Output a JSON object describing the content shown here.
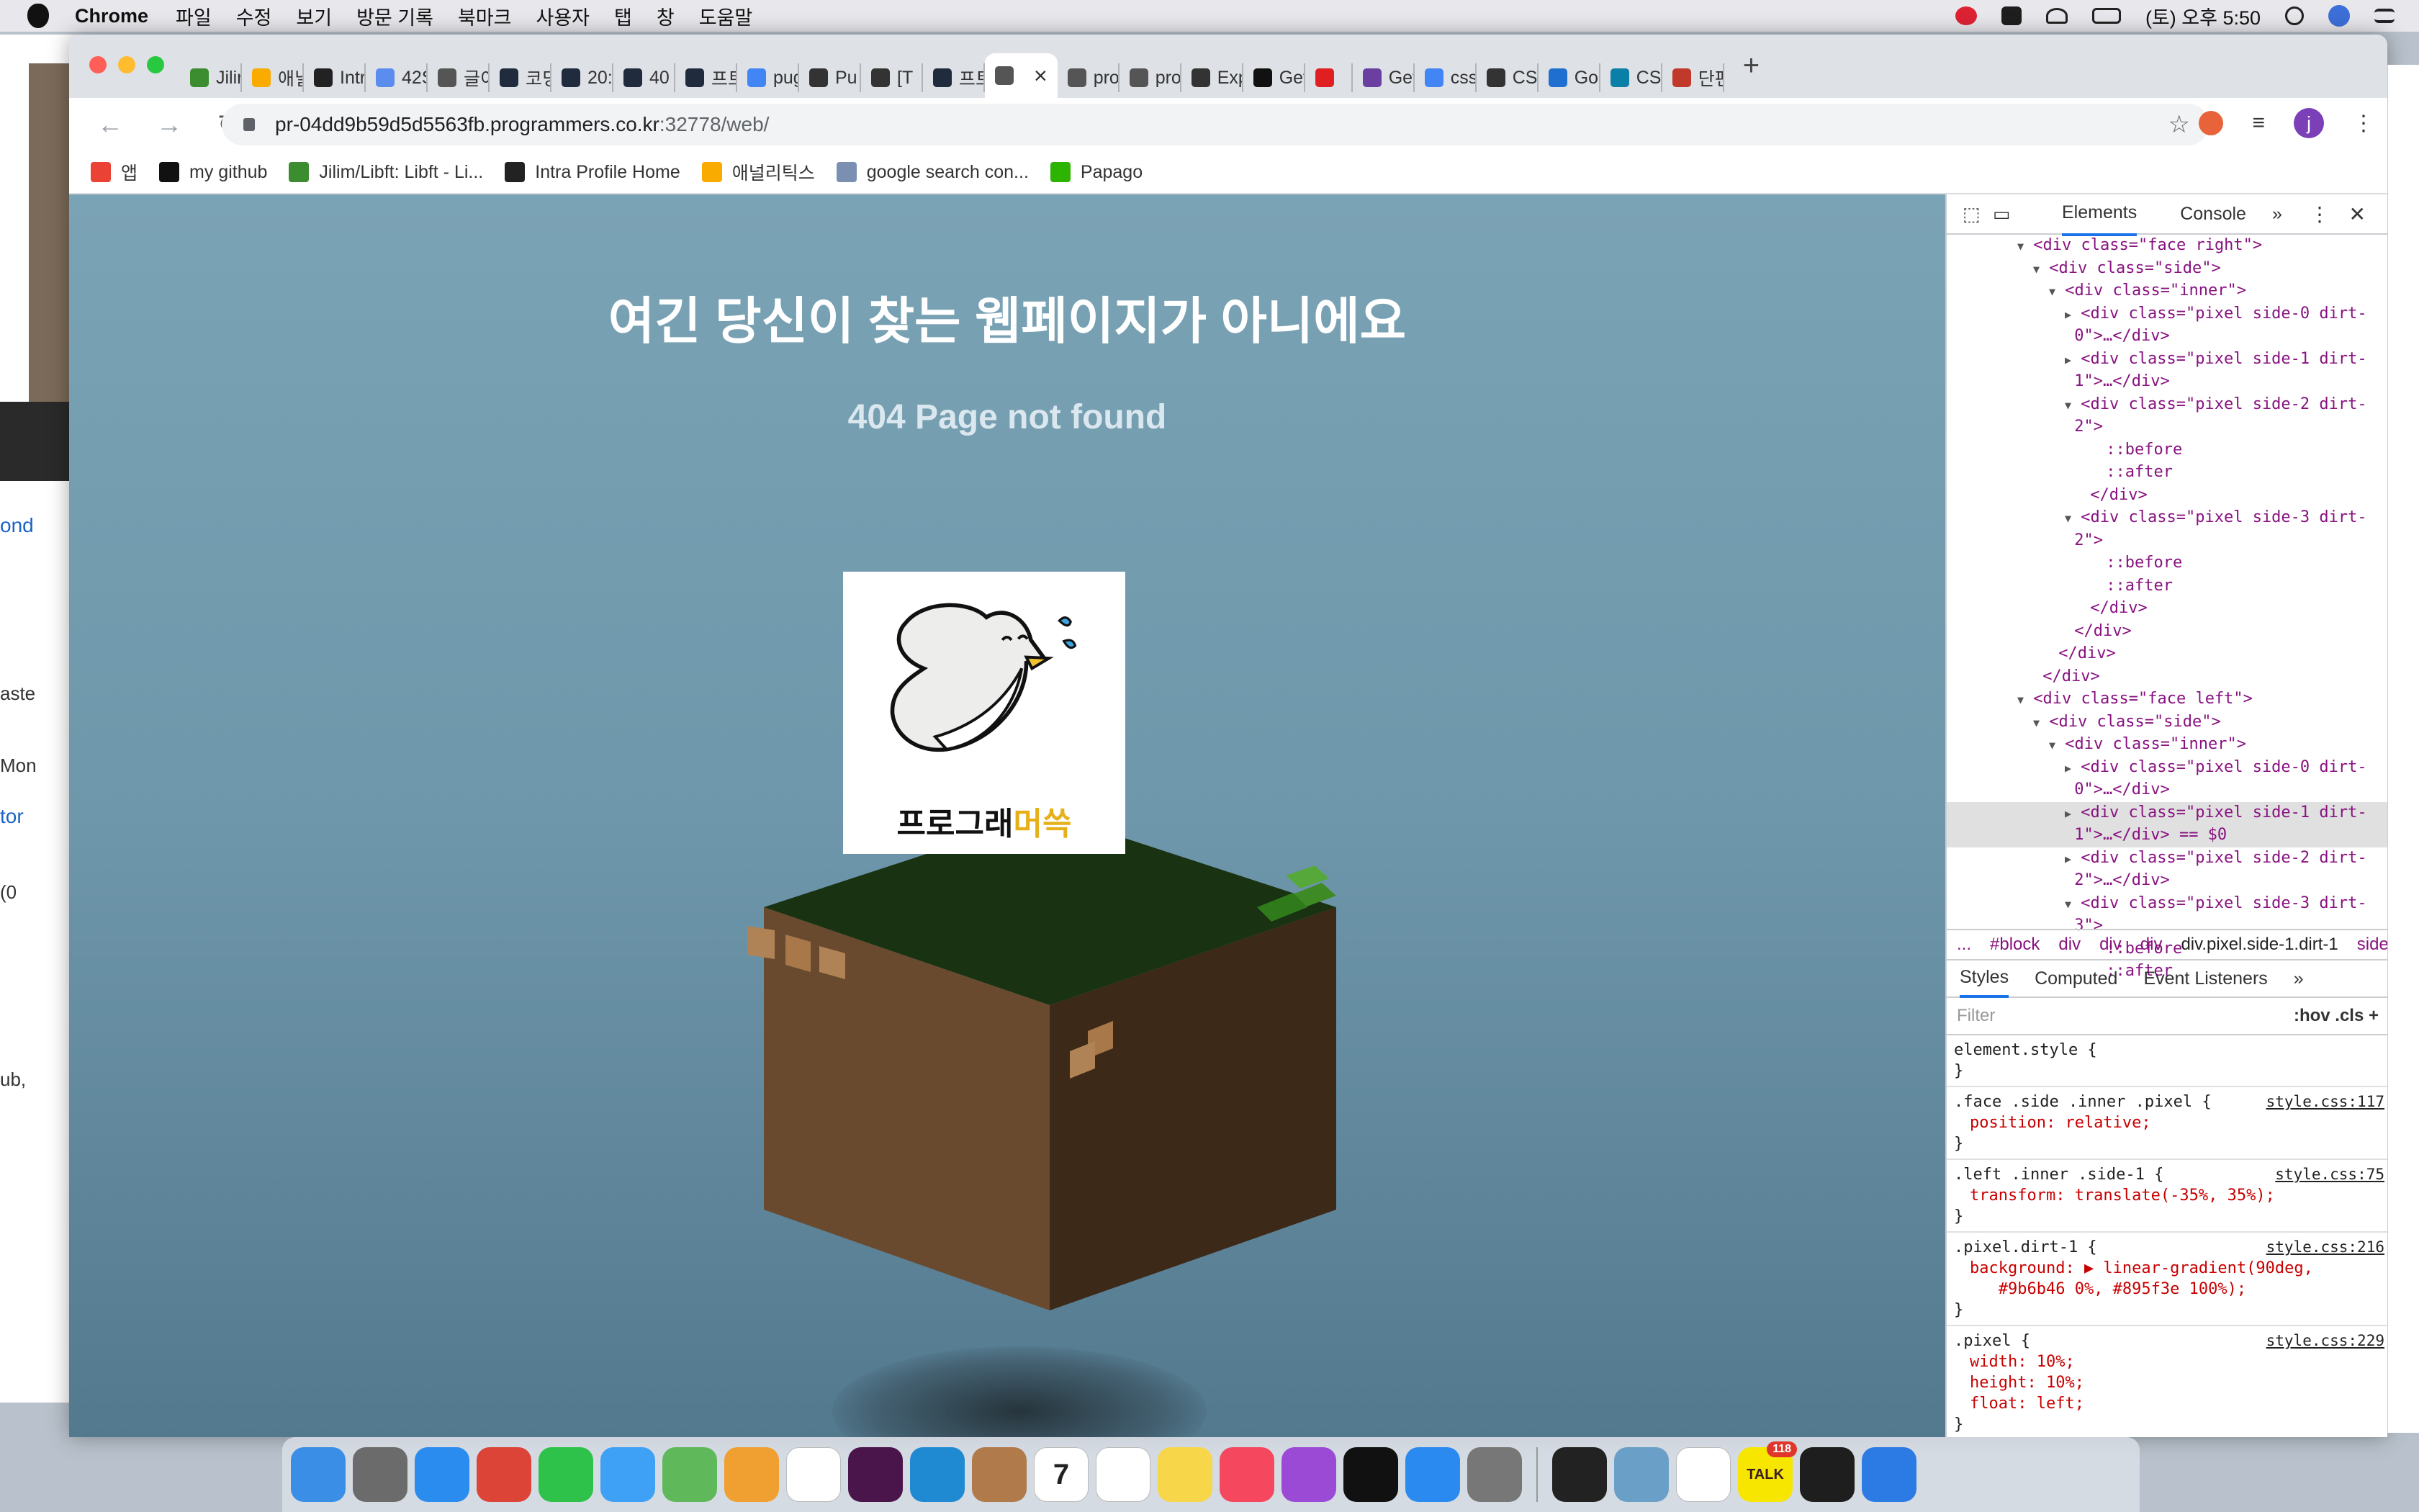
{
  "menubar": {
    "app": "Chrome",
    "items": [
      "파일",
      "수정",
      "보기",
      "방문 기록",
      "북마크",
      "사용자",
      "탭",
      "창",
      "도움말"
    ],
    "clock": "(토) 오후 5:50"
  },
  "background_window": {
    "texts": [
      "ond",
      "aste",
      "Mon",
      "tor",
      "(0",
      "ub,"
    ]
  },
  "tabs": [
    {
      "label": "Jilir",
      "color": "#3c8d2f"
    },
    {
      "label": "애닐",
      "color": "#f9ab00"
    },
    {
      "label": "Intr",
      "color": "#222"
    },
    {
      "label": "42S",
      "color": "#5b8def"
    },
    {
      "label": "글이",
      "color": "#555"
    },
    {
      "label": "코딩",
      "color": "#202b3d"
    },
    {
      "label": "20:",
      "color": "#202b3d"
    },
    {
      "label": "40",
      "color": "#202b3d"
    },
    {
      "label": "프트",
      "color": "#202b3d"
    },
    {
      "label": "pug",
      "color": "#4285f4"
    },
    {
      "label": "Pu",
      "color": "#333"
    },
    {
      "label": "[T",
      "color": "#333"
    },
    {
      "label": "프트",
      "color": "#202b3d"
    },
    {
      "label": "",
      "color": "#555",
      "active": true
    },
    {
      "label": "pro",
      "color": "#555"
    },
    {
      "label": "pro",
      "color": "#555"
    },
    {
      "label": "Exp",
      "color": "#333"
    },
    {
      "label": "Get",
      "color": "#111"
    },
    {
      "label": "",
      "color": "#e02020"
    },
    {
      "label": "Get",
      "color": "#6b3fa0"
    },
    {
      "label": "css",
      "color": "#4285f4"
    },
    {
      "label": "CS",
      "color": "#333"
    },
    {
      "label": "Go",
      "color": "#1f6fd1"
    },
    {
      "label": "CS",
      "color": "#0a7fa8"
    },
    {
      "label": "단편",
      "color": "#c0392b"
    }
  ],
  "omnibox": {
    "host": "pr-04dd9b59d5d5563fb.programmers.co.kr",
    "rest": ":32778/web/"
  },
  "bookmarks": [
    {
      "label": "앱",
      "color": "#ea4335"
    },
    {
      "label": "my github",
      "color": "#111"
    },
    {
      "label": "Jilim/Libft: Libft - Li...",
      "color": "#3c8d2f"
    },
    {
      "label": "Intra Profile Home",
      "color": "#222"
    },
    {
      "label": "애널리틱스",
      "color": "#f9ab00"
    },
    {
      "label": "google search con...",
      "color": "#7b8fb0"
    },
    {
      "label": "Papago",
      "color": "#2db400"
    }
  ],
  "page": {
    "title": "여긴 당신이 찾는 웹페이지가 아니에요",
    "subtitle": "404 Page not found",
    "logo_text_1": "프로그래",
    "logo_text_2": "머쓱"
  },
  "devtools": {
    "tabs": {
      "elements": "Elements",
      "console": "Console",
      "more": "»"
    },
    "dom_lines": [
      {
        "indent": 4,
        "arrow": "▼",
        "html": "<div class=\"face right\">"
      },
      {
        "indent": 5,
        "arrow": "▼",
        "html": "<div class=\"side\">"
      },
      {
        "indent": 6,
        "arrow": "▼",
        "html": "<div class=\"inner\">"
      },
      {
        "indent": 7,
        "arrow": "▶",
        "html": "<div class=\"pixel side-0 dirt-"
      },
      {
        "indent": 7,
        "arrow": "",
        "html": "0\">…</div>"
      },
      {
        "indent": 7,
        "arrow": "▶",
        "html": "<div class=\"pixel side-1 dirt-"
      },
      {
        "indent": 7,
        "arrow": "",
        "html": "1\">…</div>"
      },
      {
        "indent": 7,
        "arrow": "▼",
        "html": "<div class=\"pixel side-2 dirt-"
      },
      {
        "indent": 7,
        "arrow": "",
        "html": "2\">"
      },
      {
        "indent": 9,
        "arrow": "",
        "html": "::before"
      },
      {
        "indent": 9,
        "arrow": "",
        "html": "::after"
      },
      {
        "indent": 8,
        "arrow": "",
        "html": "</div>"
      },
      {
        "indent": 7,
        "arrow": "▼",
        "html": "<div class=\"pixel side-3 dirt-"
      },
      {
        "indent": 7,
        "arrow": "",
        "html": "2\">"
      },
      {
        "indent": 9,
        "arrow": "",
        "html": "::before"
      },
      {
        "indent": 9,
        "arrow": "",
        "html": "::after"
      },
      {
        "indent": 8,
        "arrow": "",
        "html": "</div>"
      },
      {
        "indent": 7,
        "arrow": "",
        "html": "</div>"
      },
      {
        "indent": 6,
        "arrow": "",
        "html": "</div>"
      },
      {
        "indent": 5,
        "arrow": "",
        "html": "</div>"
      },
      {
        "indent": 4,
        "arrow": "▼",
        "html": "<div class=\"face left\">"
      },
      {
        "indent": 5,
        "arrow": "▼",
        "html": "<div class=\"side\">"
      },
      {
        "indent": 6,
        "arrow": "▼",
        "html": "<div class=\"inner\">"
      },
      {
        "indent": 7,
        "arrow": "▶",
        "html": "<div class=\"pixel side-0 dirt-"
      },
      {
        "indent": 7,
        "arrow": "",
        "html": "0\">…</div>"
      },
      {
        "indent": 7,
        "arrow": "▶",
        "html": "<div class=\"pixel side-1 dirt-",
        "hl": true
      },
      {
        "indent": 7,
        "arrow": "",
        "html": "1\">…</div> == $0",
        "hl": true
      },
      {
        "indent": 7,
        "arrow": "▶",
        "html": "<div class=\"pixel side-2 dirt-"
      },
      {
        "indent": 7,
        "arrow": "",
        "html": "2\">…</div>"
      },
      {
        "indent": 7,
        "arrow": "▼",
        "html": "<div class=\"pixel side-3 dirt-"
      },
      {
        "indent": 7,
        "arrow": "",
        "html": "3\">"
      },
      {
        "indent": 9,
        "arrow": "",
        "html": "::before"
      },
      {
        "indent": 9,
        "arrow": "",
        "html": "::after"
      }
    ],
    "crumbs": [
      "...",
      "#block",
      "div",
      "div",
      "div",
      "div.pixel.side-1.dirt-1",
      "side-"
    ],
    "style_tabs": {
      "styles": "Styles",
      "computed": "Computed",
      "listeners": "Event Listeners",
      "more": "»"
    },
    "filter": {
      "placeholder": "Filter",
      "toggles": ":hov  .cls  +"
    },
    "rules": [
      {
        "selector": "element.style {",
        "source": "",
        "props": [],
        "close": "}"
      },
      {
        "selector": ".face .side .inner .pixel {",
        "source": "style.css:117",
        "props": [
          "position: relative;"
        ],
        "close": "}"
      },
      {
        "selector": ".left .inner .side-1 {",
        "source": "style.css:75",
        "props": [
          "transform: translate(-35%, 35%);"
        ],
        "close": "}"
      },
      {
        "selector": ".pixel.dirt-1 {",
        "source": "style.css:216",
        "props": [
          "background: ▶ linear-gradient(90deg,",
          "   #9b6b46 0%, #895f3e 100%);"
        ],
        "close": "}"
      },
      {
        "selector": ".pixel {",
        "source": "style.css:229",
        "props": [
          "width: 10%;",
          "height: 10%;",
          "float: left;"
        ],
        "close": "}"
      }
    ]
  },
  "dock": {
    "apps": [
      {
        "name": "finder",
        "color": "#3a8ee6"
      },
      {
        "name": "launchpad",
        "color": "#6b6b6b"
      },
      {
        "name": "safari",
        "color": "#2b8cf0"
      },
      {
        "name": "chrome",
        "color": "#db4437"
      },
      {
        "name": "facetime",
        "color": "#2fc24a"
      },
      {
        "name": "messages",
        "color": "#3fa1f5"
      },
      {
        "name": "maps",
        "color": "#5fb85a"
      },
      {
        "name": "photos",
        "color": "#f0a030"
      },
      {
        "name": "notion",
        "color": "#ffffff"
      },
      {
        "name": "slack",
        "color": "#4a154b"
      },
      {
        "name": "vscode",
        "color": "#1f8ad2"
      },
      {
        "name": "contacts",
        "color": "#b07a4a"
      },
      {
        "name": "calendar",
        "color": "#ffffff"
      },
      {
        "name": "reminders",
        "color": "#ffffff"
      },
      {
        "name": "notes",
        "color": "#f7d64a"
      },
      {
        "name": "music",
        "color": "#f5485e"
      },
      {
        "name": "podcasts",
        "color": "#9b4ad6"
      },
      {
        "name": "tv",
        "color": "#111111"
      },
      {
        "name": "appstore",
        "color": "#2a8af0"
      },
      {
        "name": "preferences",
        "color": "#777777"
      },
      {
        "name": "terminal",
        "color": "#222222"
      },
      {
        "name": "preview",
        "color": "#6aa0c8"
      },
      {
        "name": "typora",
        "color": "#ffffff"
      },
      {
        "name": "kakaotalk",
        "color": "#f7e600"
      },
      {
        "name": "iterm",
        "color": "#1e1e1e"
      },
      {
        "name": "navigator",
        "color": "#2c7be5"
      }
    ],
    "calendar_day": "7",
    "kakaotalk_badge": "118",
    "talk_label": "TALK"
  }
}
